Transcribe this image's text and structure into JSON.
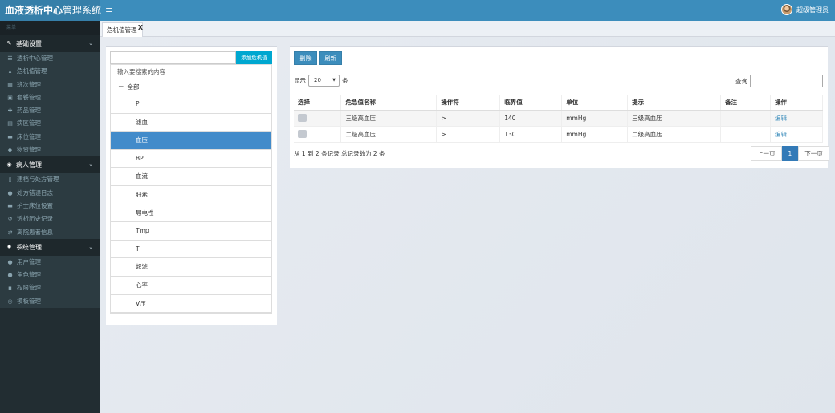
{
  "app": {
    "title_bold": "血液透析中心",
    "title_rest": "管理系统",
    "menu_icon": "≡",
    "user_name": "超级管理员"
  },
  "sidebar": {
    "label": "菜单",
    "groups": [
      {
        "label": "基础设置",
        "icon": "edit-icon",
        "items": [
          {
            "label": "透析中心管理",
            "icon": "list-icon"
          },
          {
            "label": "危机值管理",
            "icon": "alert-icon"
          },
          {
            "label": "班次管理",
            "icon": "calendar-icon"
          },
          {
            "label": "套餐管理",
            "icon": "box-icon"
          },
          {
            "label": "药品管理",
            "icon": "medicine-icon"
          },
          {
            "label": "病区管理",
            "icon": "grid-icon"
          },
          {
            "label": "床位管理",
            "icon": "bed-icon"
          },
          {
            "label": "物资管理",
            "icon": "tag-icon"
          }
        ]
      },
      {
        "label": "病人管理",
        "icon": "camera-icon",
        "items": [
          {
            "label": "建档与处方管理",
            "icon": "file-icon"
          },
          {
            "label": "处方错误日志",
            "icon": "info-icon"
          },
          {
            "label": "护士床位设置",
            "icon": "bed-icon"
          },
          {
            "label": "透析历史记录",
            "icon": "history-icon"
          },
          {
            "label": "离院患者信息",
            "icon": "exchange-icon"
          }
        ]
      },
      {
        "label": "系统管理",
        "icon": "gear-icon",
        "items": [
          {
            "label": "用户管理",
            "icon": "user-icon"
          },
          {
            "label": "角色管理",
            "icon": "users-icon"
          },
          {
            "label": "权限管理",
            "icon": "lock-icon"
          },
          {
            "label": "模板管理",
            "icon": "template-icon"
          }
        ]
      }
    ]
  },
  "tab": {
    "label": "危机值管理",
    "close": "X"
  },
  "left_panel": {
    "add_button": "添加危机值",
    "search_placeholder": "输入要搜索的内容",
    "root": "全部",
    "nodes": [
      "P",
      "滤血",
      "血压",
      "BP",
      "血流",
      "肝素",
      "导电性",
      "Tmp",
      "T",
      "超滤",
      "心率",
      "V压"
    ],
    "selected_index": 2
  },
  "toolbar": {
    "delete_label": "删除",
    "refresh_label": "刷新"
  },
  "list_controls": {
    "show_label": "显示",
    "page_size": "20",
    "unit_label": "条",
    "search_label": "查询"
  },
  "table": {
    "headers": [
      "选择",
      "危急值名称",
      "操作符",
      "临界值",
      "单位",
      "提示",
      "备注",
      "操作"
    ],
    "rows": [
      {
        "name": "三级高血压",
        "operator": ">",
        "value": "140",
        "unit": "mmHg",
        "hint": "三级高血压",
        "note": "",
        "action": "编辑"
      },
      {
        "name": "二级高血压",
        "operator": ">",
        "value": "130",
        "unit": "mmHg",
        "hint": "二级高血压",
        "note": "",
        "action": "编辑"
      }
    ]
  },
  "footer": {
    "summary": "从 1 到 2 条记录 总记录数为 2 条",
    "prev": "上一页",
    "page": "1",
    "next": "下一页"
  },
  "colors": {
    "topbar": "#3c8dbc",
    "sidebar": "#222d32",
    "selected": "#428bca",
    "add_button": "#00a7d0"
  }
}
